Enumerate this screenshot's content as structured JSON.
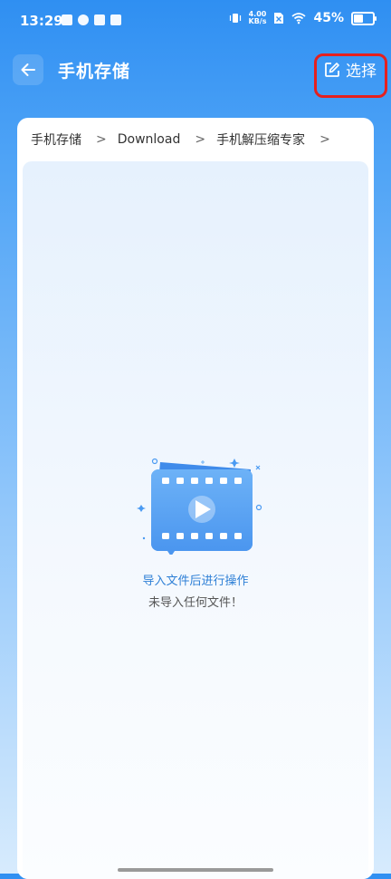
{
  "status_bar": {
    "time": "13:29",
    "net_speed_value": "4.00",
    "net_speed_unit": "KB/s",
    "battery_percent": "45%"
  },
  "app_bar": {
    "title": "手机存储",
    "select_label": "选择"
  },
  "breadcrumb": [
    "手机存储",
    "Download",
    "手机解压缩专家"
  ],
  "empty_state": {
    "title": "导入文件后进行操作",
    "subtitle": "未导入任何文件！"
  },
  "colors": {
    "accent": "#2f8ff2",
    "highlight": "#e5201e"
  }
}
